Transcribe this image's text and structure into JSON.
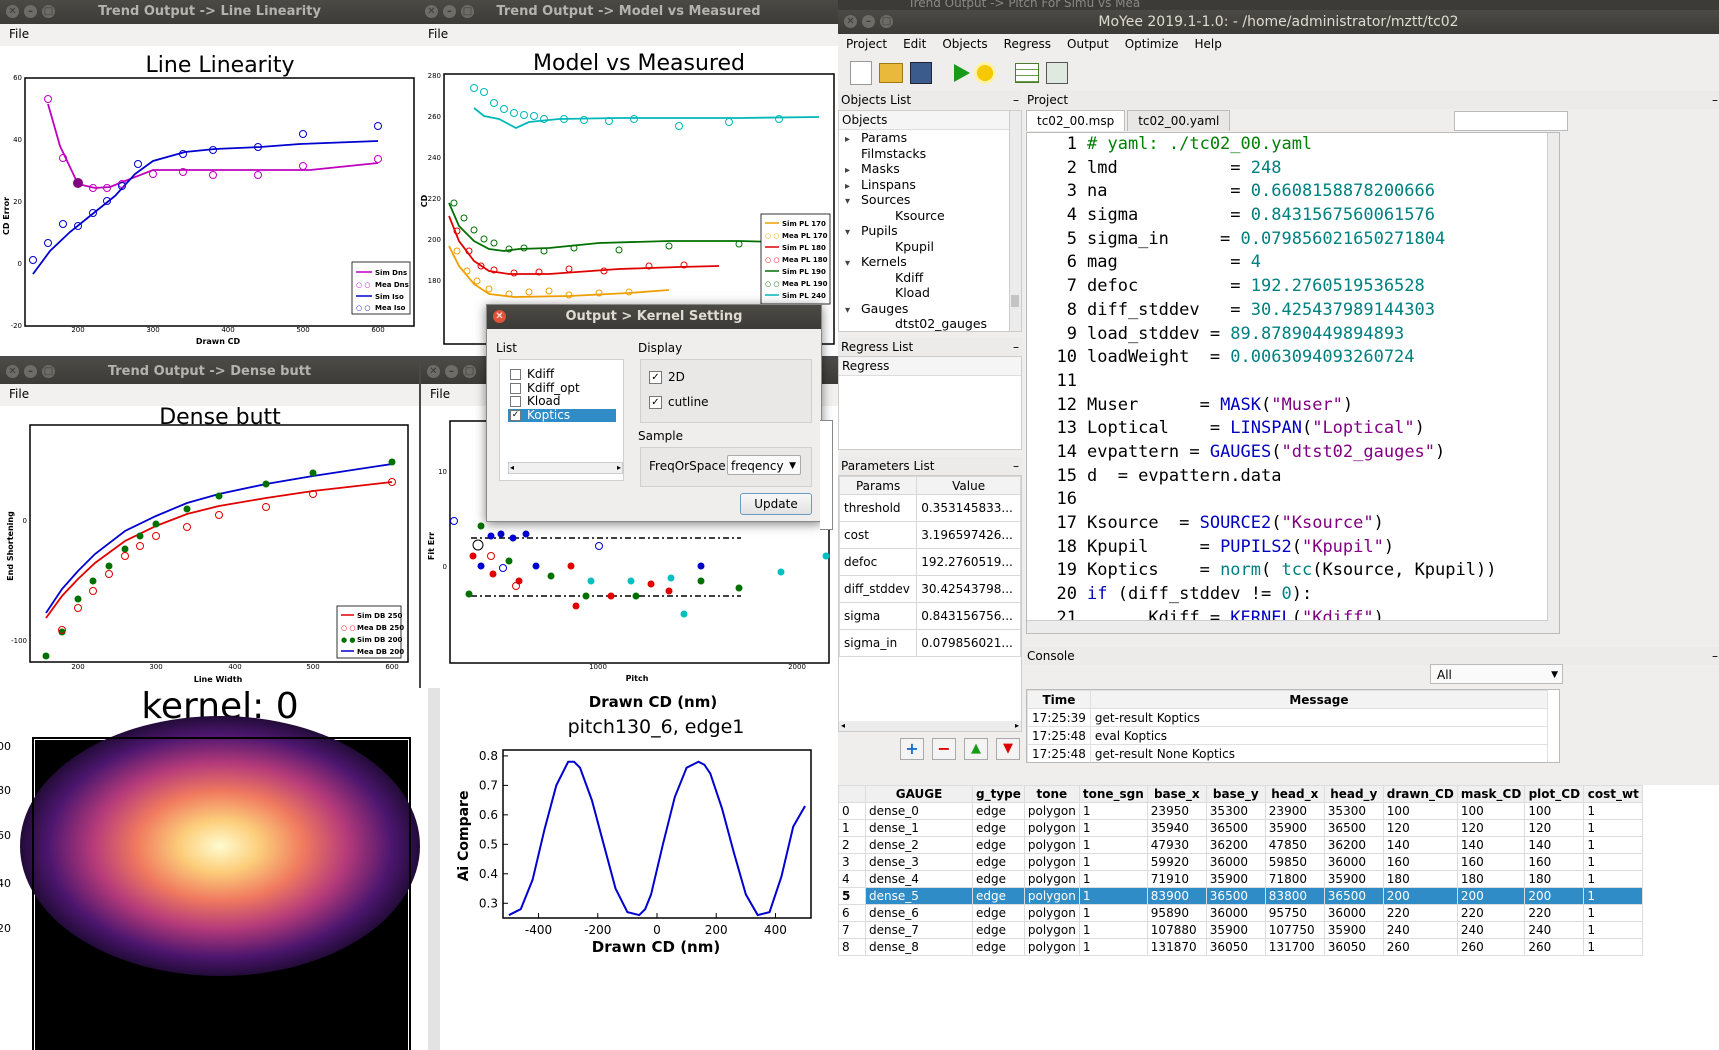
{
  "windows": {
    "line_linearity": {
      "title": "Trend Output -> Line Linearity",
      "menu": "File",
      "plot_title": "Line Linearity",
      "xlabel": "Drawn CD",
      "ylabel": "CD Error",
      "yticks": [
        "60",
        "40",
        "20",
        "0",
        "-20"
      ],
      "xticks": [
        "200",
        "300",
        "400",
        "500",
        "600"
      ],
      "legend": [
        "Sim Dns",
        "Mea Dns",
        "Sim Iso",
        "Mea Iso"
      ]
    },
    "model_vs_measured": {
      "title": "Trend Output -> Model vs Measured",
      "menu": "File",
      "plot_title": "Model vs Measured",
      "ylabel": "CD",
      "yticks": [
        "280",
        "260",
        "240",
        "220",
        "200",
        "180"
      ],
      "legend": [
        "Sim PL 170",
        "Mea PL 170",
        "Sim PL 180",
        "Mea PL 180",
        "Sim PL 190",
        "Mea PL 190",
        "Sim PL 240"
      ]
    },
    "dense_butt": {
      "title": "Trend Output -> Dense butt",
      "menu": "File",
      "plot_title": "Dense butt",
      "xlabel": "Line Width",
      "ylabel": "End Shortening",
      "yticks": [
        "0",
        "-100"
      ],
      "xticks": [
        "200",
        "300",
        "400",
        "500",
        "600"
      ],
      "legend": [
        "Sim DB 250",
        "Mea DB 250",
        "Sim DB 200",
        "Mea DB 200"
      ]
    },
    "fit_err": {
      "menu": "File",
      "xlabel": "Pitch",
      "ylabel": "Fit Err",
      "yticks": [
        "10",
        "0"
      ],
      "xticks": [
        "1000",
        "2000"
      ]
    },
    "background_title": "Trend Output -> Pitch For Simu vs Mea"
  },
  "kernel_plot": {
    "title": "kernel: 0",
    "yticks": [
      "00",
      "80",
      "60",
      "40",
      "20"
    ]
  },
  "ai_plot": {
    "top_label": "Drawn CD (nm)",
    "title": "pitch130_6, edge1",
    "ylabel": "Ai Compare",
    "xlabel": "Drawn CD (nm)",
    "yticks": [
      "0.8",
      "0.7",
      "0.6",
      "0.5",
      "0.4",
      "0.3"
    ],
    "xticks": [
      "-400",
      "-200",
      "0",
      "200",
      "400"
    ]
  },
  "chart_data": [
    {
      "type": "line",
      "title": "pitch130_6, edge1",
      "xlabel": "Drawn CD (nm)",
      "ylabel": "Ai Compare",
      "xlim": [
        -520,
        520
      ],
      "ylim": [
        0.25,
        0.82
      ],
      "series": [
        {
          "values_note": "",
          "x": [
            -500,
            -460,
            -420,
            -380,
            -340,
            -300,
            -280,
            -260,
            -220,
            -180,
            -140,
            -100,
            -60,
            -40,
            -20,
            20,
            60,
            100,
            140,
            160,
            180,
            220,
            260,
            300,
            340,
            380,
            420,
            460,
            500
          ],
          "y": [
            0.26,
            0.28,
            0.38,
            0.55,
            0.7,
            0.78,
            0.78,
            0.76,
            0.65,
            0.5,
            0.35,
            0.27,
            0.26,
            0.28,
            0.33,
            0.5,
            0.66,
            0.76,
            0.78,
            0.77,
            0.74,
            0.62,
            0.47,
            0.33,
            0.26,
            0.27,
            0.39,
            0.56,
            0.63
          ]
        }
      ]
    }
  ],
  "dialog": {
    "title": "Output > Kernel Setting",
    "list_label": "List",
    "display_label": "Display",
    "items": [
      {
        "label": "Kdiff",
        "checked": false
      },
      {
        "label": "Kdiff_opt",
        "checked": false
      },
      {
        "label": "Kload",
        "checked": false
      },
      {
        "label": "Koptics",
        "checked": true
      }
    ],
    "opt_2d": "2D",
    "opt_cutline": "cutline",
    "sample_label": "Sample",
    "freq_label": "FreqOrSpace",
    "freq_value": "freqency",
    "update": "Update"
  },
  "moyee": {
    "title": "MoYee 2019.1-1.0: - /home/administrator/mztt/tc02",
    "menu": [
      "Project",
      "Edit",
      "Objects",
      "Regress",
      "Output",
      "Optimize",
      "Help"
    ],
    "objects_list_label": "Objects List",
    "objects_root": "Objects",
    "tree": [
      {
        "label": "Params",
        "lvl": 1,
        "arrow": "▸"
      },
      {
        "label": "Filmstacks",
        "lvl": 1,
        "arrow": ""
      },
      {
        "label": "Masks",
        "lvl": 1,
        "arrow": "▸"
      },
      {
        "label": "Linspans",
        "lvl": 1,
        "arrow": "▸"
      },
      {
        "label": "Sources",
        "lvl": 1,
        "arrow": "▾"
      },
      {
        "label": "Ksource",
        "lvl": 2,
        "arrow": ""
      },
      {
        "label": "Pupils",
        "lvl": 1,
        "arrow": "▾"
      },
      {
        "label": "Kpupil",
        "lvl": 2,
        "arrow": ""
      },
      {
        "label": "Kernels",
        "lvl": 1,
        "arrow": "▾"
      },
      {
        "label": "Kdiff",
        "lvl": 2,
        "arrow": ""
      },
      {
        "label": "Kload",
        "lvl": 2,
        "arrow": ""
      },
      {
        "label": "Gauges",
        "lvl": 1,
        "arrow": "▾"
      },
      {
        "label": "dtst02_gauges",
        "lvl": 2,
        "arrow": ""
      }
    ],
    "regress_list_label": "Regress List",
    "regress_root": "Regress",
    "params_list_label": "Parameters List",
    "params_head": [
      "Params",
      "Value"
    ],
    "params": [
      [
        "threshold",
        "0.353145833..."
      ],
      [
        "cost",
        "3.196597426..."
      ],
      [
        "defoc",
        "192.2760519..."
      ],
      [
        "diff_stddev",
        "30.42543798..."
      ],
      [
        "sigma",
        "0.843156756..."
      ],
      [
        "sigma_in",
        "0.079856021..."
      ]
    ],
    "project_label": "Project",
    "tabs": [
      "tc02_00.msp",
      "tc02_00.yaml"
    ],
    "code": [
      {
        "n": "1",
        "parts": [
          {
            "c": "cmt",
            "t": "# yaml: ./tc02_00.yaml"
          }
        ]
      },
      {
        "n": "2",
        "parts": [
          {
            "c": "",
            "t": "lmd           = "
          },
          {
            "c": "grn",
            "t": "248"
          }
        ]
      },
      {
        "n": "3",
        "parts": [
          {
            "c": "",
            "t": "na            = "
          },
          {
            "c": "grn",
            "t": "0.6608158878200666"
          }
        ]
      },
      {
        "n": "4",
        "parts": [
          {
            "c": "",
            "t": "sigma         = "
          },
          {
            "c": "grn",
            "t": "0.8431567560061576"
          }
        ]
      },
      {
        "n": "5",
        "parts": [
          {
            "c": "",
            "t": "sigma_in     = "
          },
          {
            "c": "grn",
            "t": "0.079856021650271804"
          }
        ]
      },
      {
        "n": "6",
        "parts": [
          {
            "c": "",
            "t": "mag           = "
          },
          {
            "c": "grn",
            "t": "4"
          }
        ]
      },
      {
        "n": "7",
        "parts": [
          {
            "c": "",
            "t": "defoc         = "
          },
          {
            "c": "grn",
            "t": "192.2760519536528"
          }
        ]
      },
      {
        "n": "8",
        "parts": [
          {
            "c": "",
            "t": "diff_stddev   = "
          },
          {
            "c": "grn",
            "t": "30.425437989144303"
          }
        ]
      },
      {
        "n": "9",
        "parts": [
          {
            "c": "",
            "t": "load_stddev = "
          },
          {
            "c": "grn",
            "t": "89.87890449894893"
          }
        ]
      },
      {
        "n": "10",
        "parts": [
          {
            "c": "",
            "t": "loadWeight  = "
          },
          {
            "c": "grn",
            "t": "0.0063094093260724"
          }
        ]
      },
      {
        "n": "11",
        "parts": []
      },
      {
        "n": "12",
        "parts": [
          {
            "c": "",
            "t": "Muser      = "
          },
          {
            "c": "blu",
            "t": "MASK"
          },
          {
            "c": "",
            "t": "("
          },
          {
            "c": "pur",
            "t": "\"Muser\""
          },
          {
            "c": "",
            "t": ")"
          }
        ]
      },
      {
        "n": "13",
        "parts": [
          {
            "c": "",
            "t": "Loptical    = "
          },
          {
            "c": "blu",
            "t": "LINSPAN"
          },
          {
            "c": "",
            "t": "("
          },
          {
            "c": "pur",
            "t": "\"Loptical\""
          },
          {
            "c": "",
            "t": ")"
          }
        ]
      },
      {
        "n": "14",
        "parts": [
          {
            "c": "",
            "t": "evpattern = "
          },
          {
            "c": "blu",
            "t": "GAUGES"
          },
          {
            "c": "",
            "t": "("
          },
          {
            "c": "pur",
            "t": "\"dtst02_gauges\""
          },
          {
            "c": "",
            "t": ")"
          }
        ]
      },
      {
        "n": "15",
        "parts": [
          {
            "c": "",
            "t": "d  = evpattern.data"
          }
        ]
      },
      {
        "n": "16",
        "parts": []
      },
      {
        "n": "17",
        "parts": [
          {
            "c": "",
            "t": "Ksource  = "
          },
          {
            "c": "blu",
            "t": "SOURCE2"
          },
          {
            "c": "",
            "t": "("
          },
          {
            "c": "pur",
            "t": "\"Ksource\""
          },
          {
            "c": "",
            "t": ")"
          }
        ]
      },
      {
        "n": "18",
        "parts": [
          {
            "c": "",
            "t": "Kpupil     = "
          },
          {
            "c": "blu",
            "t": "PUPILS2"
          },
          {
            "c": "",
            "t": "("
          },
          {
            "c": "pur",
            "t": "\"Kpupil\""
          },
          {
            "c": "",
            "t": ")"
          }
        ]
      },
      {
        "n": "19",
        "parts": [
          {
            "c": "",
            "t": "Koptics    = "
          },
          {
            "c": "grn",
            "t": "norm"
          },
          {
            "c": "",
            "t": "( "
          },
          {
            "c": "grn",
            "t": "tcc"
          },
          {
            "c": "",
            "t": "(Ksource, Kpupil))"
          }
        ]
      },
      {
        "n": "20",
        "parts": [
          {
            "c": "blu",
            "t": "if"
          },
          {
            "c": "",
            "t": " (diff_stddev != "
          },
          {
            "c": "grn",
            "t": "0"
          },
          {
            "c": "",
            "t": "):"
          }
        ]
      },
      {
        "n": "21",
        "parts": [
          {
            "c": "",
            "t": "      Kdiff = "
          },
          {
            "c": "blu",
            "t": "KERNEL"
          },
          {
            "c": "",
            "t": "("
          },
          {
            "c": "pur",
            "t": "\"Kdiff\""
          },
          {
            "c": "",
            "t": ")"
          }
        ]
      }
    ],
    "console_label": "Console",
    "console_filter": "All",
    "console_head": [
      "Time",
      "Message"
    ],
    "console": [
      [
        "17:25:39",
        "get-result  Koptics"
      ],
      [
        "17:25:48",
        "eval  Koptics"
      ],
      [
        "17:25:48",
        "get-result None Koptics"
      ]
    ],
    "gauge_head": [
      "",
      "GAUGE",
      "g_type",
      "tone",
      "tone_sgn",
      "base_x",
      "base_y",
      "head_x",
      "head_y",
      "drawn_CD",
      "mask_CD",
      "plot_CD",
      "cost_wt"
    ],
    "gauges": [
      [
        "0",
        "dense_0",
        "edge",
        "polygon",
        "1",
        "23950",
        "35300",
        "23900",
        "35300",
        "100",
        "100",
        "100",
        "1"
      ],
      [
        "1",
        "dense_1",
        "edge",
        "polygon",
        "1",
        "35940",
        "36500",
        "35900",
        "36500",
        "120",
        "120",
        "120",
        "1"
      ],
      [
        "2",
        "dense_2",
        "edge",
        "polygon",
        "1",
        "47930",
        "36200",
        "47850",
        "36200",
        "140",
        "140",
        "140",
        "1"
      ],
      [
        "3",
        "dense_3",
        "edge",
        "polygon",
        "1",
        "59920",
        "36000",
        "59850",
        "36000",
        "160",
        "160",
        "160",
        "1"
      ],
      [
        "4",
        "dense_4",
        "edge",
        "polygon",
        "1",
        "71910",
        "35900",
        "71800",
        "35900",
        "180",
        "180",
        "180",
        "1"
      ],
      [
        "5",
        "dense_5",
        "edge",
        "polygon",
        "1",
        "83900",
        "36500",
        "83800",
        "36500",
        "200",
        "200",
        "200",
        "1"
      ],
      [
        "6",
        "dense_6",
        "edge",
        "polygon",
        "1",
        "95890",
        "36000",
        "95750",
        "36000",
        "220",
        "220",
        "220",
        "1"
      ],
      [
        "7",
        "dense_7",
        "edge",
        "polygon",
        "1",
        "107880",
        "35900",
        "107750",
        "35900",
        "240",
        "240",
        "240",
        "1"
      ],
      [
        "8",
        "dense_8",
        "edge",
        "polygon",
        "1",
        "131870",
        "36050",
        "131700",
        "36050",
        "260",
        "260",
        "260",
        "1"
      ]
    ],
    "selected_gauge": 5
  }
}
